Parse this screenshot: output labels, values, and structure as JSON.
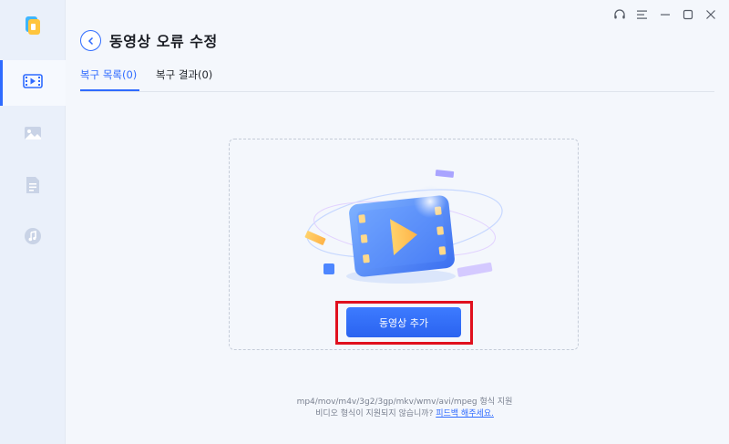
{
  "app": {
    "title": "동영상 오류 수정"
  },
  "sidebar": {
    "items": [
      {
        "name": "video",
        "icon": "video-icon",
        "active": true
      },
      {
        "name": "photo",
        "icon": "photo-icon",
        "active": false
      },
      {
        "name": "document",
        "icon": "document-icon",
        "active": false
      },
      {
        "name": "audio",
        "icon": "music-icon",
        "active": false
      }
    ]
  },
  "titlebar": {
    "icons": [
      "headset-icon",
      "menu-icon",
      "minimize-icon",
      "maximize-icon",
      "close-icon"
    ]
  },
  "tabs": [
    {
      "label": "복구 목록(0)",
      "active": true
    },
    {
      "label": "복구 결과(0)",
      "active": false
    }
  ],
  "main": {
    "add_button_label": "동영상 추가",
    "supported_formats": "mp4/mov/m4v/3g2/3gp/mkv/wmv/avi/mpeg 형식 지원",
    "unsupported_question": "비디오 형식이 지원되지 않습니까?",
    "feedback_link": "피드백 해주세요."
  },
  "colors": {
    "accent": "#2f6bff",
    "highlight": "#e0101e",
    "background": "#f4f7fc",
    "sidebar": "#eaf0fa"
  }
}
